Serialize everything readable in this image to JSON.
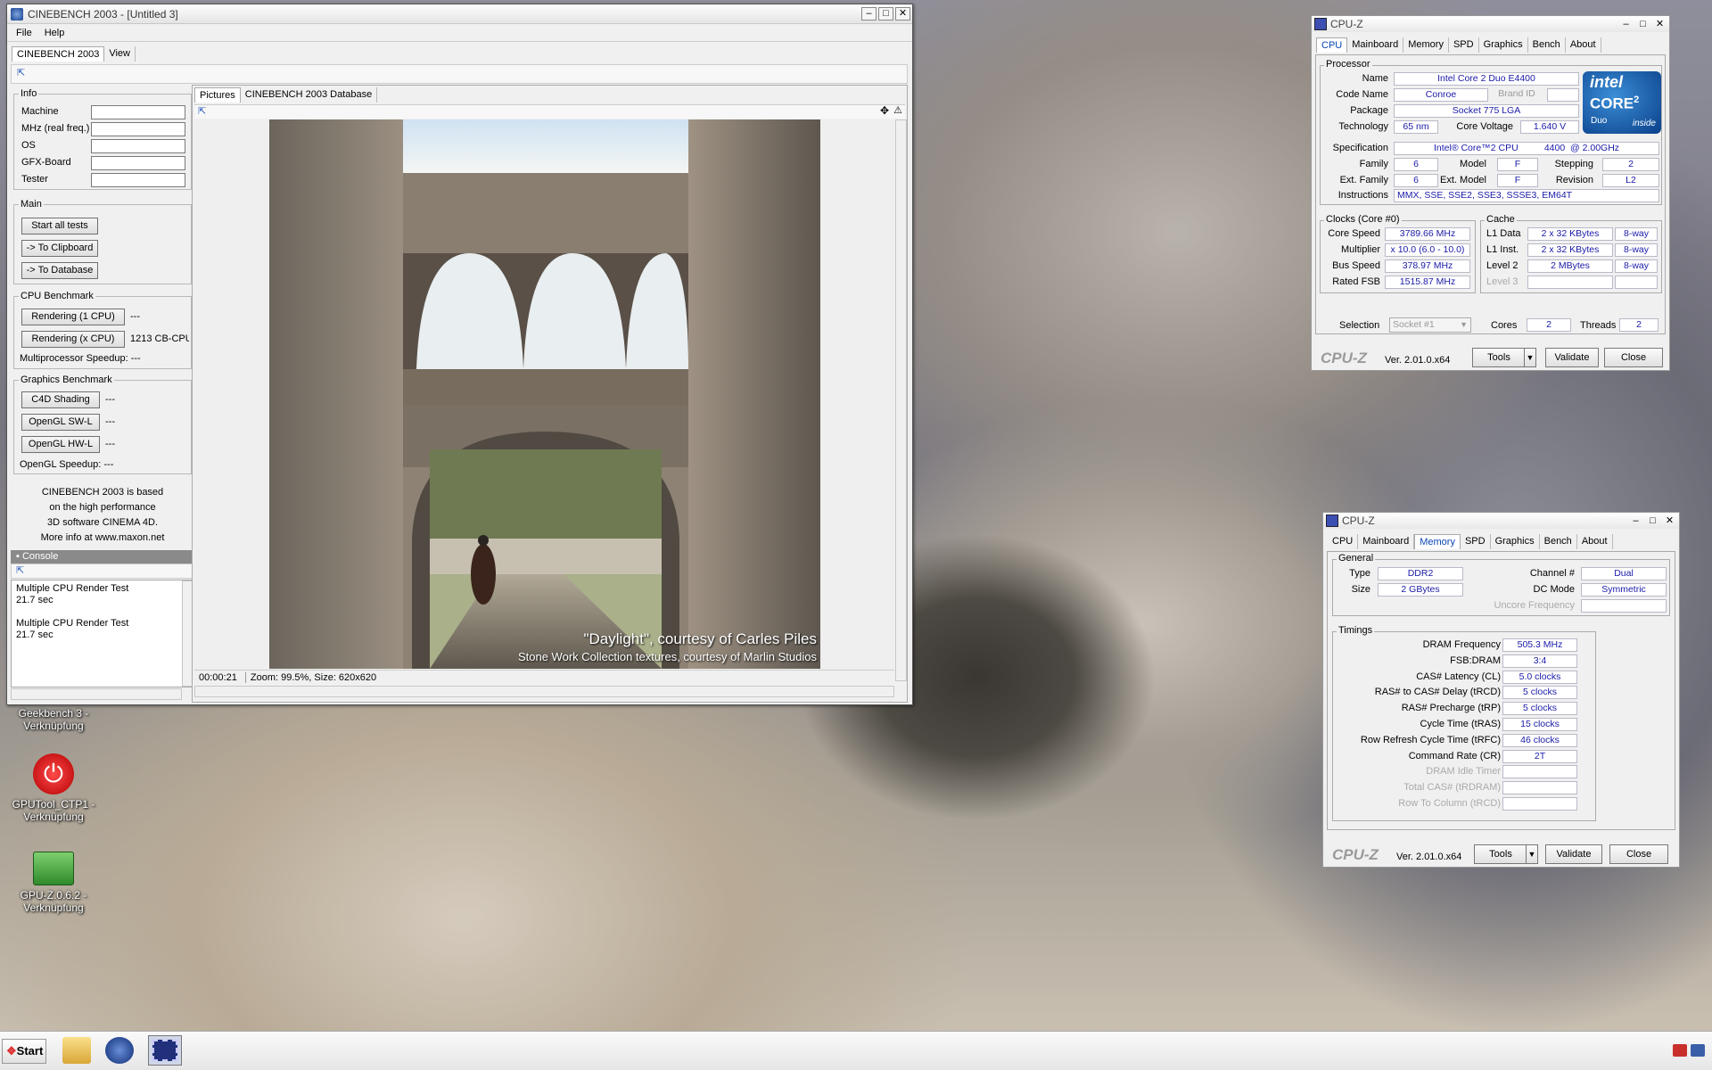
{
  "cinebench": {
    "title": "CINEBENCH 2003 - [Untitled 3]",
    "menu": [
      "File",
      "Help"
    ],
    "tabs": [
      "CINEBENCH 2003",
      "View"
    ],
    "info": {
      "label": "Info",
      "fields": [
        "Machine",
        "MHz (real freq.)",
        "OS",
        "GFX-Board",
        "Tester"
      ]
    },
    "main": {
      "label": "Main",
      "buttons": [
        "Start all tests",
        "-> To Clipboard",
        "-> To Database"
      ]
    },
    "cpu": {
      "label": "CPU Benchmark",
      "btn1": "Rendering (1 CPU)",
      "val1": "---",
      "btn2": "Rendering (x CPU)",
      "val2": "1213 CB-CPU",
      "speedup": "Multiprocessor Speedup: ---"
    },
    "gfx": {
      "label": "Graphics Benchmark",
      "btn1": "C4D Shading",
      "val1": "---",
      "btn2": "OpenGL SW-L",
      "val2": "---",
      "btn3": "OpenGL HW-L",
      "val3": "---",
      "speedup": "OpenGL Speedup: ---"
    },
    "about": [
      "CINEBENCH 2003 is based",
      "on the high performance",
      "3D software CINEMA 4D.",
      "More info at www.maxon.net"
    ],
    "console": {
      "label": "Console",
      "lines": [
        "Multiple CPU Render Test",
        "21.7 sec",
        "",
        "Multiple CPU Render Test",
        "21.7 sec"
      ]
    },
    "pic_tabs": [
      "Pictures",
      "CINEBENCH 2003 Database"
    ],
    "caption1": "\"Daylight\", courtesy of Carles Piles",
    "caption2": "Stone Work Collection textures, courtesy of Marlin Studios",
    "status": "00:00:21",
    "status2": "Zoom: 99.5%, Size: 620x620"
  },
  "cpuz1": {
    "title": "CPU-Z",
    "tabs": [
      "CPU",
      "Mainboard",
      "Memory",
      "SPD",
      "Graphics",
      "Bench",
      "About"
    ],
    "active": 0,
    "processor": {
      "label": "Processor",
      "name_l": "Name",
      "name": "Intel Core 2 Duo E4400",
      "code_l": "Code Name",
      "code": "Conroe",
      "brand_l": "Brand ID",
      "pkg_l": "Package",
      "pkg": "Socket 775 LGA",
      "tech_l": "Technology",
      "tech": "65 nm",
      "volt_l": "Core Voltage",
      "volt": "1.640 V",
      "spec_l": "Specification",
      "spec": "Intel® Core™2 CPU          4400  @ 2.00GHz",
      "fam_l": "Family",
      "fam": "6",
      "model_l": "Model",
      "model": "F",
      "step_l": "Stepping",
      "step": "2",
      "efam_l": "Ext. Family",
      "efam": "6",
      "emodel_l": "Ext. Model",
      "emodel": "F",
      "rev_l": "Revision",
      "rev": "L2",
      "ins_l": "Instructions",
      "ins": "MMX, SSE, SSE2, SSE3, SSSE3, EM64T"
    },
    "logo": {
      "brand": "intel",
      "line": "CORE",
      "sup": "2",
      "sub": "Duo",
      "inside": "inside"
    },
    "clocks": {
      "label": "Clocks (Core #0)",
      "cs_l": "Core Speed",
      "cs": "3789.66 MHz",
      "mul_l": "Multiplier",
      "mul": "x 10.0 (6.0 - 10.0)",
      "bus_l": "Bus Speed",
      "bus": "378.97 MHz",
      "fsb_l": "Rated FSB",
      "fsb": "1515.87 MHz"
    },
    "cache": {
      "label": "Cache",
      "l1d_l": "L1 Data",
      "l1d": "2 x 32 KBytes",
      "l1d_w": "8-way",
      "l1i_l": "L1 Inst.",
      "l1i": "2 x 32 KBytes",
      "l1i_w": "8-way",
      "l2_l": "Level 2",
      "l2": "2 MBytes",
      "l2_w": "8-way",
      "l3_l": "Level 3"
    },
    "sel_l": "Selection",
    "sel": "Socket #1",
    "cores_l": "Cores",
    "cores": "2",
    "threads_l": "Threads",
    "threads": "2",
    "brand": "CPU-Z",
    "ver": "Ver. 2.01.0.x64",
    "tools": "Tools",
    "validate": "Validate",
    "close": "Close"
  },
  "cpuz2": {
    "title": "CPU-Z",
    "tabs": [
      "CPU",
      "Mainboard",
      "Memory",
      "SPD",
      "Graphics",
      "Bench",
      "About"
    ],
    "active": 2,
    "general": {
      "label": "General",
      "type_l": "Type",
      "type": "DDR2",
      "size_l": "Size",
      "size": "2 GBytes",
      "ch_l": "Channel #",
      "ch": "Dual",
      "dc_l": "DC Mode",
      "dc": "Symmetric",
      "unc_l": "Uncore Frequency"
    },
    "timings": {
      "label": "Timings",
      "rows": [
        {
          "l": "DRAM Frequency",
          "v": "505.3 MHz"
        },
        {
          "l": "FSB:DRAM",
          "v": "3:4"
        },
        {
          "l": "CAS# Latency (CL)",
          "v": "5.0 clocks"
        },
        {
          "l": "RAS# to CAS# Delay (tRCD)",
          "v": "5 clocks"
        },
        {
          "l": "RAS# Precharge (tRP)",
          "v": "5 clocks"
        },
        {
          "l": "Cycle Time (tRAS)",
          "v": "15 clocks"
        },
        {
          "l": "Row Refresh Cycle Time (tRFC)",
          "v": "46 clocks"
        },
        {
          "l": "Command Rate (CR)",
          "v": "2T"
        },
        {
          "l": "DRAM Idle Timer",
          "v": ""
        },
        {
          "l": "Total CAS# (tRDRAM)",
          "v": ""
        },
        {
          "l": "Row To Column (tRCD)",
          "v": ""
        }
      ]
    },
    "brand": "CPU-Z",
    "ver": "Ver. 2.01.0.x64",
    "tools": "Tools",
    "validate": "Validate",
    "close": "Close"
  },
  "desktop": {
    "icon1": "Geekbench 3 -\nVerknüpfung",
    "icon2": "GPUTool_CTP1 -\nVerknüpfung",
    "icon3": "GPU-Z.0.6.2 -\nVerknüpfung"
  },
  "taskbar": {
    "start": "Start"
  }
}
